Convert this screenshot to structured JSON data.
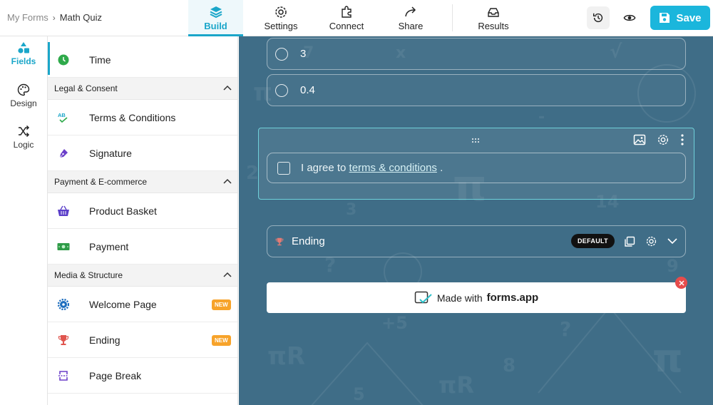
{
  "breadcrumb": {
    "root": "My Forms",
    "current": "Math Quiz"
  },
  "nav": {
    "build": "Build",
    "settings": "Settings",
    "connect": "Connect",
    "share": "Share",
    "results": "Results"
  },
  "toolbar": {
    "save_label": "Save"
  },
  "rail": {
    "fields": "Fields",
    "design": "Design",
    "logic": "Logic"
  },
  "panel": {
    "time": "Time",
    "sections": {
      "legal": "Legal & Consent",
      "payment": "Payment & E-commerce",
      "media": "Media & Structure"
    },
    "legal_items": [
      "Terms & Conditions",
      "Signature"
    ],
    "payment_items": [
      "Product Basket",
      "Payment"
    ],
    "media_items": [
      "Welcome Page",
      "Ending",
      "Page Break"
    ],
    "new_badge": "NEW"
  },
  "canvas": {
    "options": [
      "3",
      "0.4"
    ],
    "agree_prefix": "I agree to ",
    "agree_link": "terms & conditions",
    "agree_suffix": " .",
    "ending_label": "Ending",
    "default_badge": "DEFAULT",
    "made_with": "Made with",
    "brand": "forms.app"
  },
  "colors": {
    "accent": "#1aa6c9",
    "save": "#1bb6dc",
    "canvas_bg": "#3f6d87",
    "badge": "#f7a32a"
  }
}
